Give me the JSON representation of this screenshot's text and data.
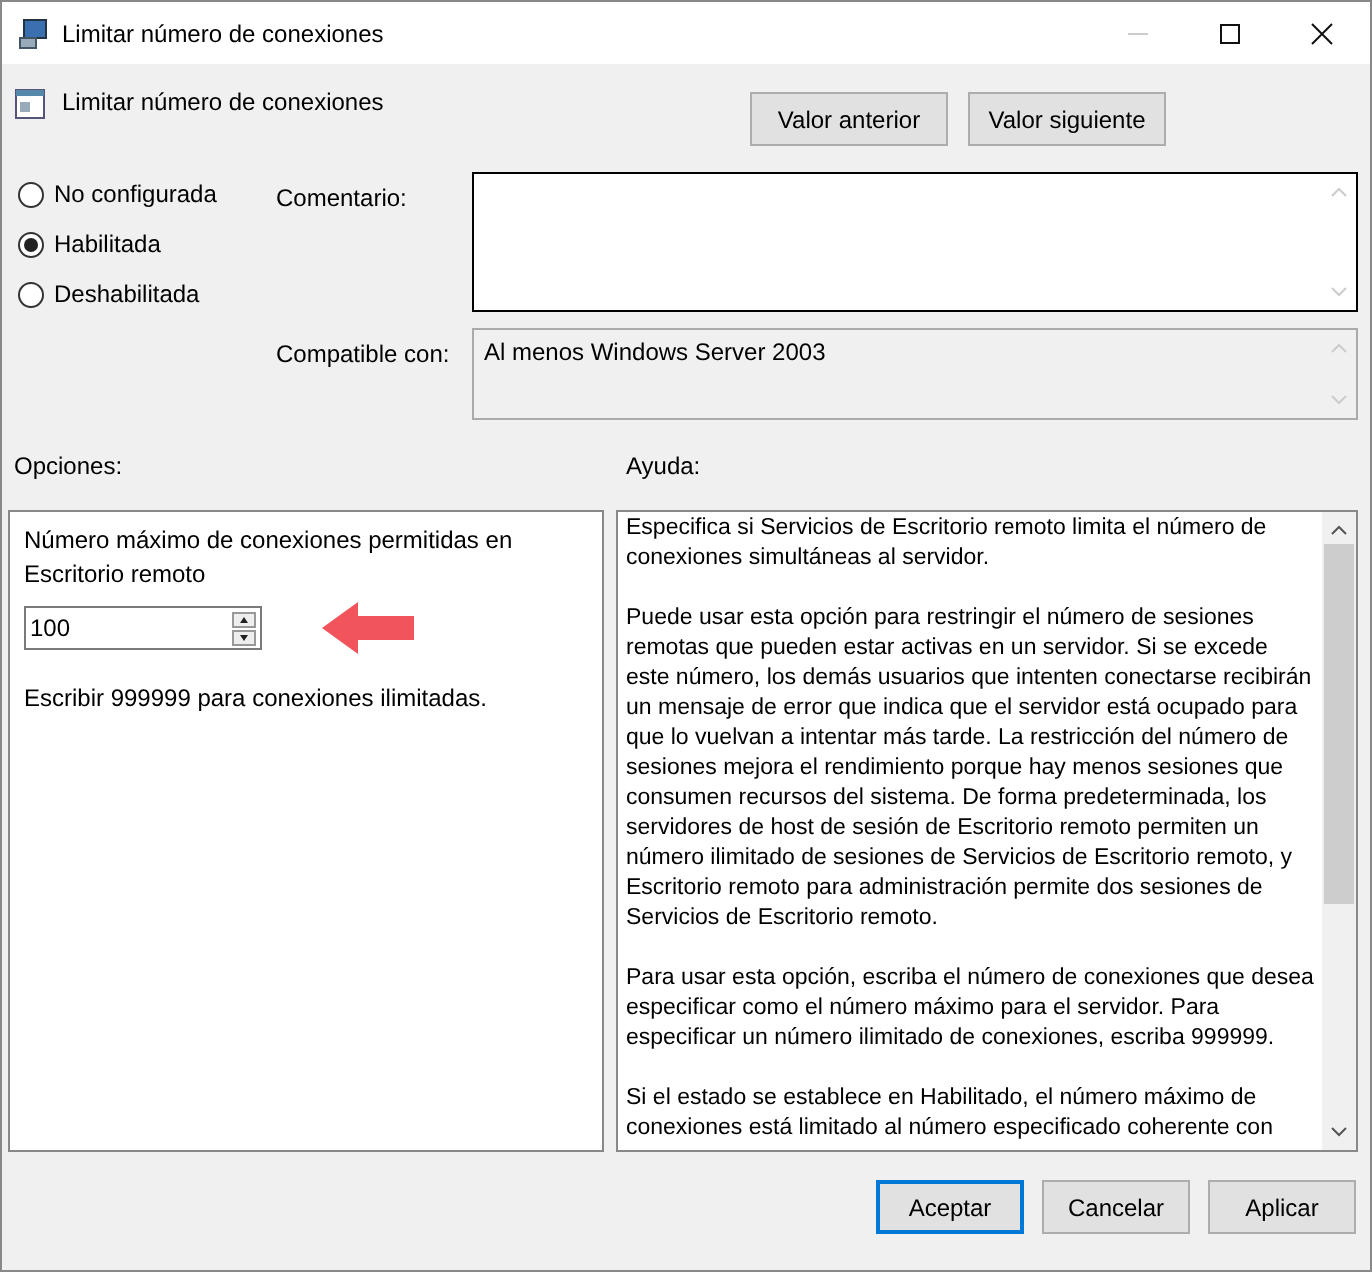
{
  "window": {
    "title": "Limitar número de conexiones"
  },
  "setting": {
    "title": "Limitar número de conexiones"
  },
  "nav_buttons": [
    "Valor anterior",
    "Valor siguiente"
  ],
  "states": [
    {
      "label": "No configurada",
      "selected": false
    },
    {
      "label": "Habilitada",
      "selected": true
    },
    {
      "label": "Deshabilitada",
      "selected": false
    }
  ],
  "comment": {
    "label": "Comentario:"
  },
  "compatible": {
    "label": "Compatible con:",
    "value": "Al menos Windows Server 2003"
  },
  "options": {
    "label": "Opciones:",
    "field_label": "Número máximo de conexiones permitidas en Escritorio remoto",
    "value": "100",
    "note": "Escribir 999999 para conexiones ilimitadas."
  },
  "help": {
    "label": "Ayuda:",
    "paragraphs": [
      "Especifica si Servicios de Escritorio remoto limita el número de conexiones simultáneas al servidor.",
      "Puede usar esta opción para restringir el número de sesiones remotas que pueden estar activas en un servidor. Si se excede este número, los demás usuarios que intenten conectarse recibirán un mensaje de error que indica que el servidor está ocupado para que lo vuelvan a intentar más tarde. La restricción del número de sesiones mejora el rendimiento porque hay menos sesiones que consumen recursos del sistema. De forma predeterminada, los servidores de host de sesión de Escritorio remoto permiten un número ilimitado de sesiones de Servicios de Escritorio remoto, y Escritorio remoto para administración permite dos sesiones de Servicios de Escritorio remoto.",
      "Para usar esta opción, escriba el número de conexiones que desea especificar como el número máximo para el servidor. Para especificar un número ilimitado de conexiones, escriba 999999.",
      "Si el estado se establece en Habilitado, el número máximo de conexiones está limitado al número especificado coherente con"
    ]
  },
  "footer_buttons": [
    {
      "label": "Aceptar",
      "default": true
    },
    {
      "label": "Cancelar",
      "default": false
    },
    {
      "label": "Aplicar",
      "default": false
    }
  ]
}
